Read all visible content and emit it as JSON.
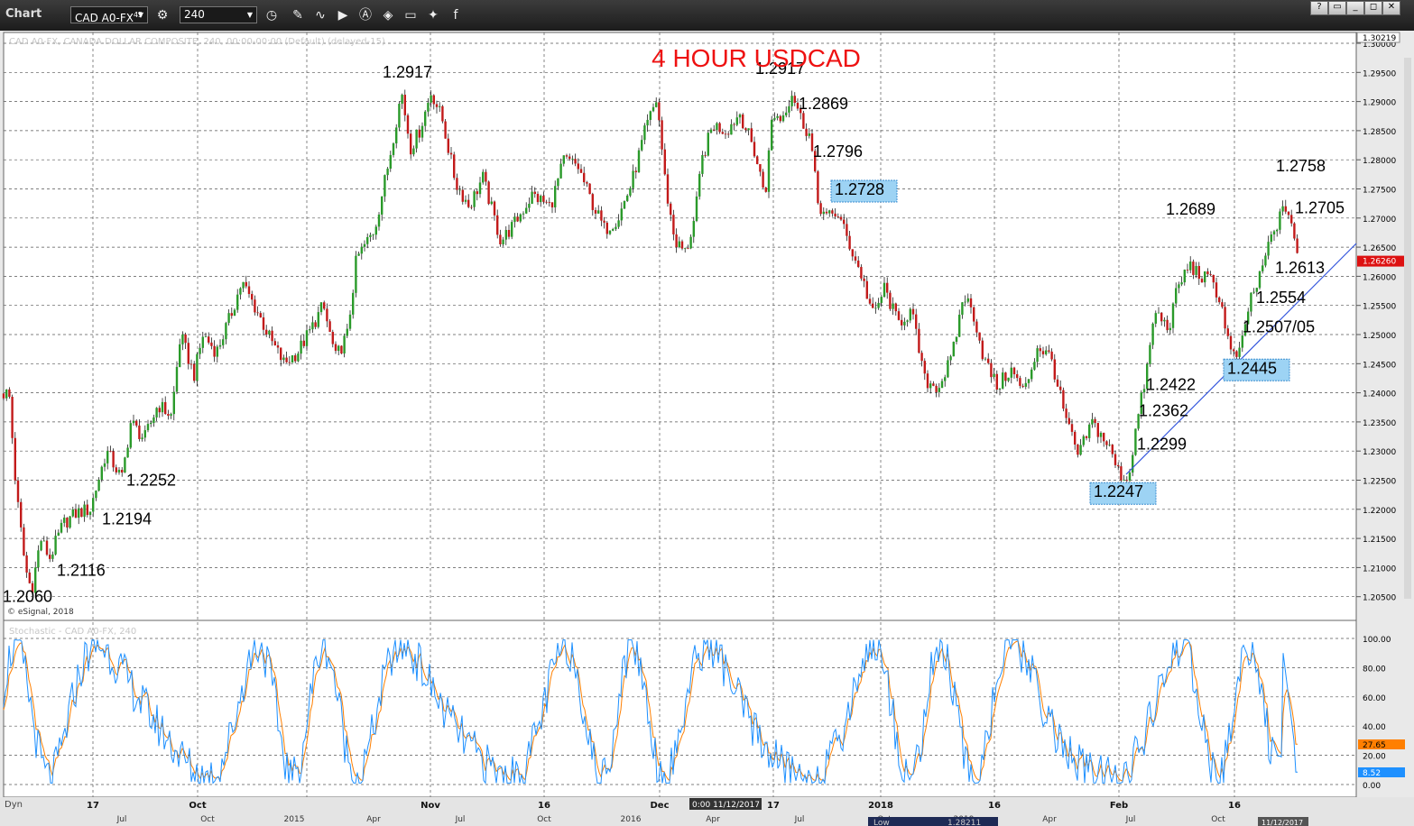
{
  "toolbar": {
    "title": "Chart",
    "symbol": "CAD A0-FX",
    "symbol_sup": "45",
    "interval": "240",
    "icons": [
      "settings-icon",
      "clock-icon",
      "pencil-icon",
      "wave-icon",
      "play-icon",
      "alert-icon",
      "tag-icon",
      "chat-icon",
      "twitter-icon",
      "facebook-icon"
    ]
  },
  "chart_data": {
    "type": "candlestick",
    "title": "4 HOUR USDCAD",
    "price_header": "1.30219",
    "last_price": "1.26260",
    "watermark": "© eSignal, 2018",
    "symbol_line": "CAD A0-FX, CANADA DOLLAR COMPOSITE, 240, 00:00-00:00 (Default) (delayed-15)",
    "y_ticks": [
      "1.30000",
      "1.29500",
      "1.29000",
      "1.28500",
      "1.28000",
      "1.27500",
      "1.27000",
      "1.26500",
      "1.26000",
      "1.25500",
      "1.25000",
      "1.24500",
      "1.24000",
      "1.23500",
      "1.23000",
      "1.22500",
      "1.22000",
      "1.21500",
      "1.21000",
      "1.20500"
    ],
    "x_ticks_top": [
      "17",
      "Oct",
      "Nov",
      "16",
      "Dec",
      "17",
      "2018",
      "16",
      "Feb",
      "16"
    ],
    "x_ticks_bottom": [
      "Jul",
      "Oct",
      "2015",
      "Apr",
      "Jul",
      "Oct",
      "2016",
      "Apr",
      "Jul",
      "Oct",
      "2019",
      "Apr",
      "Jul",
      "Oct"
    ],
    "cursor_label": "0:00 11/12/2017",
    "path": [
      [
        0,
        1.2398
      ],
      [
        10,
        1.24
      ],
      [
        18,
        1.223
      ],
      [
        28,
        1.21
      ],
      [
        35,
        1.206
      ],
      [
        45,
        1.215
      ],
      [
        55,
        1.2116
      ],
      [
        70,
        1.2175
      ],
      [
        85,
        1.2194
      ],
      [
        100,
        1.22
      ],
      [
        118,
        1.23
      ],
      [
        135,
        1.2252
      ],
      [
        145,
        1.235
      ],
      [
        160,
        1.232
      ],
      [
        175,
        1.238
      ],
      [
        190,
        1.236
      ],
      [
        200,
        1.25
      ],
      [
        215,
        1.243
      ],
      [
        225,
        1.25
      ],
      [
        240,
        1.247
      ],
      [
        255,
        1.253
      ],
      [
        268,
        1.259
      ],
      [
        285,
        1.254
      ],
      [
        300,
        1.249
      ],
      [
        315,
        1.245
      ],
      [
        330,
        1.247
      ],
      [
        345,
        1.251
      ],
      [
        358,
        1.255
      ],
      [
        372,
        1.246
      ],
      [
        385,
        1.25
      ],
      [
        395,
        1.263
      ],
      [
        415,
        1.268
      ],
      [
        430,
        1.279
      ],
      [
        445,
        1.2917
      ],
      [
        455,
        1.282
      ],
      [
        465,
        1.285
      ],
      [
        478,
        1.2917
      ],
      [
        490,
        1.287
      ],
      [
        505,
        1.276
      ],
      [
        520,
        1.272
      ],
      [
        535,
        1.277
      ],
      [
        555,
        1.266
      ],
      [
        570,
        1.269
      ],
      [
        590,
        1.274
      ],
      [
        610,
        1.272
      ],
      [
        625,
        1.28
      ],
      [
        640,
        1.279
      ],
      [
        655,
        1.273
      ],
      [
        670,
        1.268
      ],
      [
        685,
        1.27
      ],
      [
        700,
        1.276
      ],
      [
        715,
        1.285
      ],
      [
        728,
        1.2905
      ],
      [
        738,
        1.275
      ],
      [
        748,
        1.266
      ],
      [
        760,
        1.264
      ],
      [
        770,
        1.27
      ],
      [
        778,
        1.28
      ],
      [
        790,
        1.286
      ],
      [
        805,
        1.285
      ],
      [
        820,
        1.288
      ],
      [
        835,
        1.282
      ],
      [
        848,
        1.274
      ],
      [
        856,
        1.288
      ],
      [
        866,
        1.287
      ],
      [
        878,
        1.2917
      ],
      [
        888,
        1.2869
      ],
      [
        898,
        1.284
      ],
      [
        906,
        1.2728
      ],
      [
        916,
        1.27
      ],
      [
        928,
        1.271
      ],
      [
        940,
        1.266
      ],
      [
        955,
        1.26
      ],
      [
        968,
        1.253
      ],
      [
        980,
        1.258
      ],
      [
        995,
        1.252
      ],
      [
        1010,
        1.254
      ],
      [
        1025,
        1.242
      ],
      [
        1040,
        1.241
      ],
      [
        1055,
        1.246
      ],
      [
        1068,
        1.257
      ],
      [
        1080,
        1.253
      ],
      [
        1090,
        1.246
      ],
      [
        1105,
        1.241
      ],
      [
        1120,
        1.244
      ],
      [
        1135,
        1.24
      ],
      [
        1150,
        1.248
      ],
      [
        1165,
        1.246
      ],
      [
        1180,
        1.236
      ],
      [
        1195,
        1.229
      ],
      [
        1210,
        1.235
      ],
      [
        1228,
        1.231
      ],
      [
        1240,
        1.2262
      ],
      [
        1250,
        1.225
      ],
      [
        1260,
        1.235
      ],
      [
        1270,
        1.243
      ],
      [
        1280,
        1.254
      ],
      [
        1295,
        1.251
      ],
      [
        1305,
        1.258
      ],
      [
        1318,
        1.262
      ],
      [
        1330,
        1.26
      ],
      [
        1345,
        1.259
      ],
      [
        1355,
        1.254
      ],
      [
        1365,
        1.246
      ],
      [
        1375,
        1.247
      ],
      [
        1385,
        1.256
      ],
      [
        1395,
        1.259
      ],
      [
        1405,
        1.265
      ],
      [
        1415,
        1.269
      ],
      [
        1425,
        1.272
      ],
      [
        1432,
        1.269
      ],
      [
        1438,
        1.2626
      ]
    ],
    "annotations": [
      {
        "text": "1.2060",
        "x": 3,
        "price": 1.2041,
        "boxed": false
      },
      {
        "text": "1.2116",
        "x": 63,
        "price": 1.2086,
        "boxed": false
      },
      {
        "text": "1.2194",
        "x": 113,
        "price": 1.2174,
        "boxed": false
      },
      {
        "text": "1.2252",
        "x": 140,
        "price": 1.2241,
        "boxed": false
      },
      {
        "text": "1.2917",
        "x": 424,
        "price": 1.2941,
        "boxed": false
      },
      {
        "text": "1.2917",
        "x": 837,
        "price": 1.2947,
        "boxed": false
      },
      {
        "text": "1.2869",
        "x": 885,
        "price": 1.2887,
        "boxed": false
      },
      {
        "text": "1.2796",
        "x": 901,
        "price": 1.2805,
        "boxed": false
      },
      {
        "text": "1.2728",
        "x": 925,
        "price": 1.274,
        "boxed": true
      },
      {
        "text": "1.2689",
        "x": 1292,
        "price": 1.2706,
        "boxed": false
      },
      {
        "text": "1.2758",
        "x": 1414,
        "price": 1.278,
        "boxed": false
      },
      {
        "text": "1.2705",
        "x": 1435,
        "price": 1.2708,
        "boxed": false
      },
      {
        "text": "1.2613",
        "x": 1413,
        "price": 1.2605,
        "boxed": false
      },
      {
        "text": "1.2554",
        "x": 1392,
        "price": 1.2554,
        "boxed": false
      },
      {
        "text": "1.2507/05",
        "x": 1377,
        "price": 1.2504,
        "boxed": false
      },
      {
        "text": "1.2445",
        "x": 1360,
        "price": 1.2433,
        "boxed": true
      },
      {
        "text": "1.2422",
        "x": 1270,
        "price": 1.2405,
        "boxed": false
      },
      {
        "text": "1.2362",
        "x": 1262,
        "price": 1.236,
        "boxed": false
      },
      {
        "text": "1.2299",
        "x": 1260,
        "price": 1.2303,
        "boxed": false
      },
      {
        "text": "1.2247",
        "x": 1212,
        "price": 1.2221,
        "boxed": true
      }
    ],
    "stochastic": {
      "label": "Stochastic - CAD A0-FX, 240",
      "y_ticks": [
        "100.00",
        "80.00",
        "60.00",
        "40.00",
        "20.00",
        "0.00"
      ],
      "k_value": "8.52",
      "d_value": "27.65",
      "k_color": "#1e90ff",
      "d_color": "#ff7f00"
    },
    "colors": {
      "up": "#2a9a2a",
      "down": "#c21a1a",
      "title": "#ee1111",
      "box_fill": "#9dd3f4",
      "box_border": "#3f8fd0",
      "trendline": "#3355dd",
      "price_tag": "#dd1111"
    }
  },
  "footer": {
    "dyn_label": "Dyn",
    "low_label": "Low",
    "low_value": "1.28211",
    "right_date": "11/12/2017"
  }
}
